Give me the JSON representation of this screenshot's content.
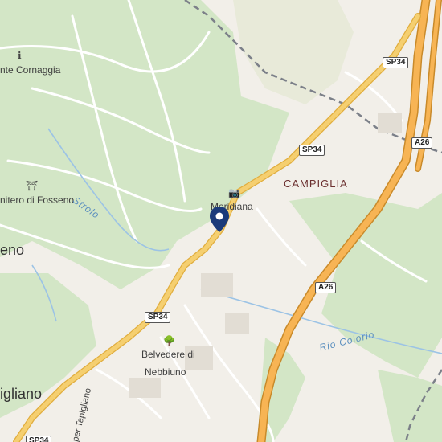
{
  "map": {
    "places": {
      "cornaggia": "nte Cornaggia",
      "fosseno": "nitero di Fosseno",
      "meridiana": "Meridiana",
      "belvedere_line1": "Belvedere di",
      "belvedere_line2": "Nebbiuno",
      "campiglia": "CAMPIGLIA",
      "eno": "eno",
      "igliano": "igliano",
      "tapigliano": "per Tapigliano"
    },
    "water": {
      "strolo": "Strolo",
      "rio_colorio": "Rio Colorio"
    },
    "roads": {
      "sp34_a": "SP34",
      "sp34_b": "SP34",
      "sp34_c": "SP34",
      "sp34_d": "SP34",
      "a26_a": "A26",
      "a26_b": "A26"
    },
    "icons": {
      "info": "info-icon",
      "cemetery": "cemetery-icon",
      "camera": "camera-icon",
      "tree": "tree-icon",
      "pin": "location-pin-icon"
    },
    "colors": {
      "background": "#f2efe9",
      "forest": "#cfe3c2",
      "motorway": "#f7b454",
      "main_road": "#f5cf70",
      "water": "#9cc3e5",
      "boundary": "#7c8089",
      "pin": "#1a3a7a"
    }
  }
}
